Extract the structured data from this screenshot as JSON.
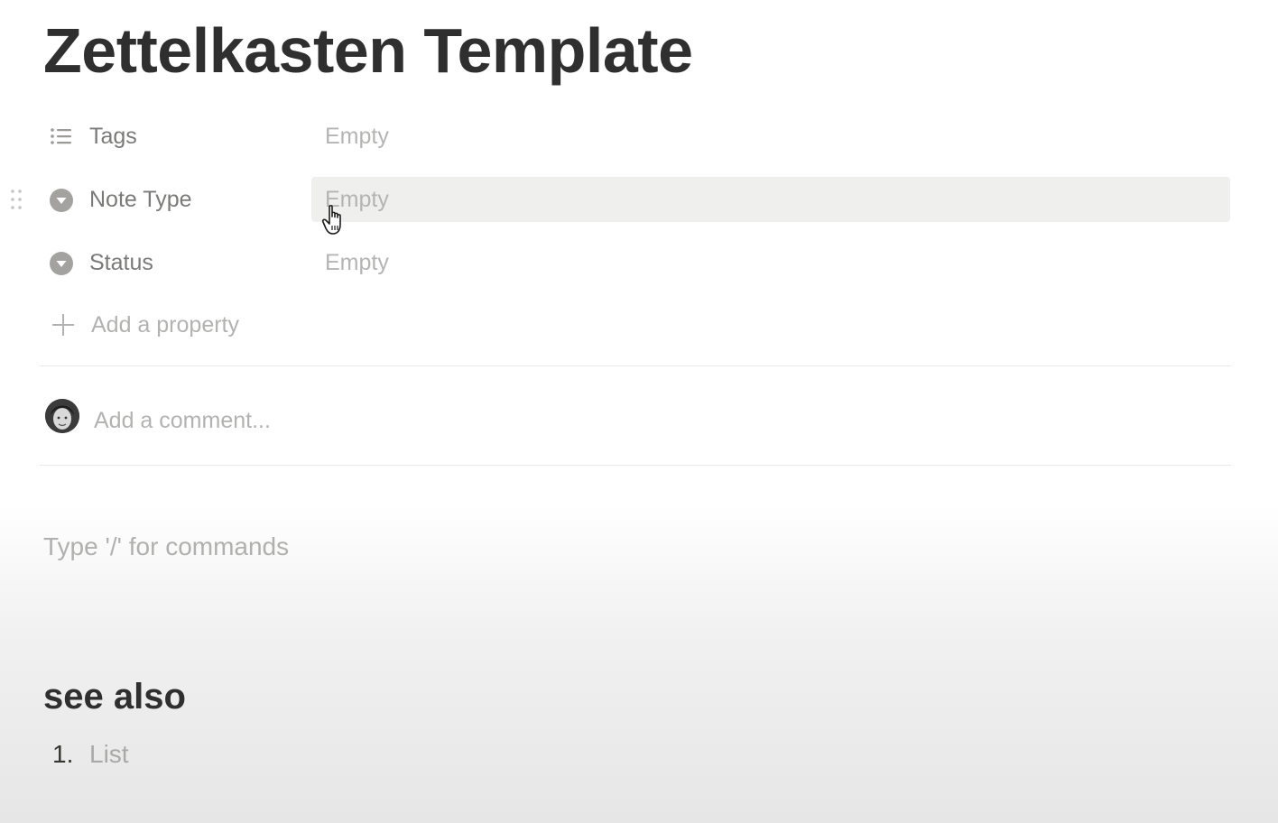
{
  "page": {
    "title": "Zettelkasten Template"
  },
  "properties": [
    {
      "name": "Tags",
      "value": "Empty",
      "icon": "list-icon"
    },
    {
      "name": "Note Type",
      "value": "Empty",
      "icon": "select-icon"
    },
    {
      "name": "Status",
      "value": "Empty",
      "icon": "select-icon"
    }
  ],
  "add_property": {
    "label": "Add a property",
    "icon": "plus-icon"
  },
  "comment": {
    "placeholder": "Add a comment..."
  },
  "body": {
    "command_hint": "Type '/' for commands",
    "section_heading": "see also",
    "list": [
      {
        "number": "1.",
        "text": "List"
      }
    ]
  },
  "colors": {
    "title": "#2f2f2f",
    "property_label": "#7a7a78",
    "placeholder": "#b4b4b2",
    "hover_row": "#efefee",
    "divider": "#e9e9e7"
  }
}
